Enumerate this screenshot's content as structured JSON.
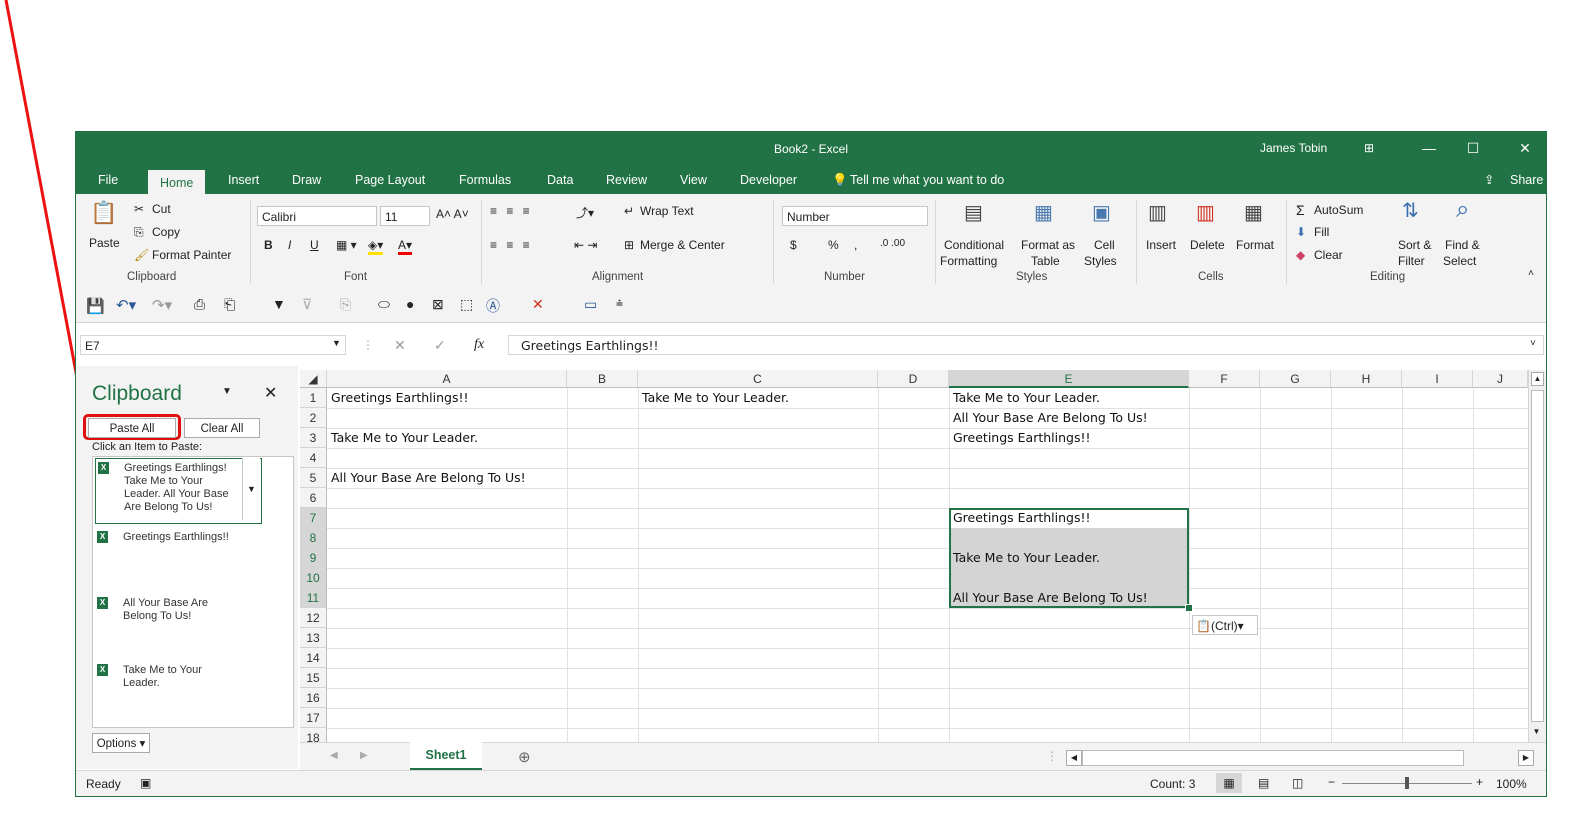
{
  "title": "Book2  -  Excel",
  "user": "James Tobin",
  "window_buttons": {
    "ribbon_opts": "⊞",
    "minimize": "—",
    "maximize": "☐",
    "close": "✕"
  },
  "tabs": [
    "File",
    "Home",
    "Insert",
    "Draw",
    "Page Layout",
    "Formulas",
    "Data",
    "Review",
    "View",
    "Developer"
  ],
  "tell_me": "Tell me what you want to do",
  "share": "Share",
  "ribbon": {
    "clipboard": {
      "paste": "Paste",
      "cut": "Cut",
      "copy": "Copy",
      "format_painter": "Format Painter",
      "label": "Clipboard"
    },
    "font": {
      "name": "Calibri",
      "size": "11",
      "bold": "B",
      "italic": "I",
      "underline": "U",
      "label": "Font"
    },
    "alignment": {
      "wrap_text": "Wrap Text",
      "merge_center": "Merge & Center",
      "label": "Alignment"
    },
    "number": {
      "format": "Number",
      "currency": "$",
      "percent": "%",
      "comma": ",",
      "label": "Number"
    },
    "styles": {
      "conditional": "Conditional",
      "formatting": "Formatting",
      "format_as": "Format as",
      "table": "Table",
      "cell": "Cell",
      "styles": "Styles",
      "label": "Styles"
    },
    "cells": {
      "insert": "Insert",
      "delete": "Delete",
      "format": "Format",
      "label": "Cells"
    },
    "editing": {
      "autosum": "AutoSum",
      "fill": "Fill",
      "clear": "Clear",
      "sort": "Sort &",
      "filter": "Filter",
      "find": "Find &",
      "select": "Select",
      "label": "Editing"
    }
  },
  "formula_bar": {
    "name_box": "E7",
    "fx": "fx",
    "value": "Greetings Earthlings!!"
  },
  "clipboard_pane": {
    "title": "Clipboard",
    "paste_all": "Paste All",
    "clear_all": "Clear All",
    "hint": "Click an Item to Paste:",
    "items": [
      [
        "Greetings Earthlings!",
        "Take Me to Your",
        "Leader. All Your Base",
        "Are Belong To Us!"
      ],
      [
        "Greetings Earthlings!!"
      ],
      [
        "All Your Base Are",
        "Belong To Us!"
      ],
      [
        "Take Me to Your",
        "Leader."
      ]
    ],
    "options": "Options"
  },
  "columns": [
    "A",
    "B",
    "C",
    "D",
    "E",
    "F",
    "G",
    "H",
    "I",
    "J"
  ],
  "rows": [
    "1",
    "2",
    "3",
    "4",
    "5",
    "6",
    "7",
    "8",
    "9",
    "10",
    "11",
    "12",
    "13",
    "14",
    "15",
    "16",
    "17",
    "18"
  ],
  "cells": {
    "A1": "Greetings Earthlings!!",
    "C1": "Take Me to Your Leader.",
    "E1": "Take Me to Your Leader.",
    "E2": "All Your Base Are Belong To Us!",
    "A3": "Take Me to Your Leader.",
    "E3": "Greetings Earthlings!!",
    "A5": "All Your Base Are Belong To Us!",
    "E7": "Greetings Earthlings!!",
    "E9": "Take Me to Your Leader.",
    "E11": "All Your Base Are Belong To Us!"
  },
  "paste_options": "(Ctrl)",
  "sheet_tab": "Sheet1",
  "status": {
    "ready": "Ready",
    "count": "Count: 3",
    "zoom": "100%"
  }
}
